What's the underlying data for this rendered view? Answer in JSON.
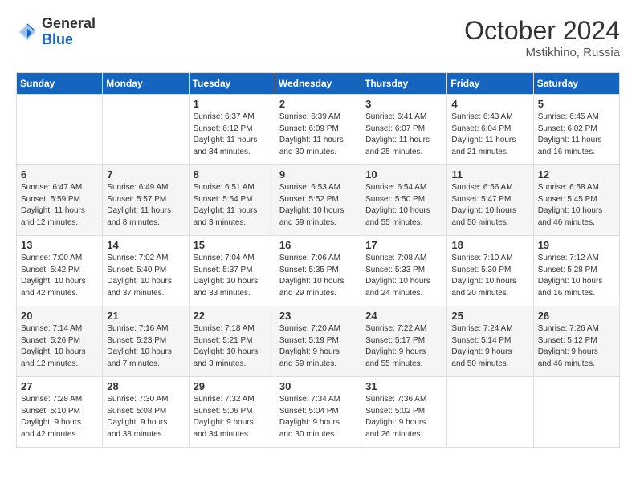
{
  "header": {
    "logo_general": "General",
    "logo_blue": "Blue",
    "month_title": "October 2024",
    "location": "Mstikhino, Russia"
  },
  "days_of_week": [
    "Sunday",
    "Monday",
    "Tuesday",
    "Wednesday",
    "Thursday",
    "Friday",
    "Saturday"
  ],
  "weeks": [
    [
      {
        "day": "",
        "content": ""
      },
      {
        "day": "",
        "content": ""
      },
      {
        "day": "1",
        "content": "Sunrise: 6:37 AM\nSunset: 6:12 PM\nDaylight: 11 hours\nand 34 minutes."
      },
      {
        "day": "2",
        "content": "Sunrise: 6:39 AM\nSunset: 6:09 PM\nDaylight: 11 hours\nand 30 minutes."
      },
      {
        "day": "3",
        "content": "Sunrise: 6:41 AM\nSunset: 6:07 PM\nDaylight: 11 hours\nand 25 minutes."
      },
      {
        "day": "4",
        "content": "Sunrise: 6:43 AM\nSunset: 6:04 PM\nDaylight: 11 hours\nand 21 minutes."
      },
      {
        "day": "5",
        "content": "Sunrise: 6:45 AM\nSunset: 6:02 PM\nDaylight: 11 hours\nand 16 minutes."
      }
    ],
    [
      {
        "day": "6",
        "content": "Sunrise: 6:47 AM\nSunset: 5:59 PM\nDaylight: 11 hours\nand 12 minutes."
      },
      {
        "day": "7",
        "content": "Sunrise: 6:49 AM\nSunset: 5:57 PM\nDaylight: 11 hours\nand 8 minutes."
      },
      {
        "day": "8",
        "content": "Sunrise: 6:51 AM\nSunset: 5:54 PM\nDaylight: 11 hours\nand 3 minutes."
      },
      {
        "day": "9",
        "content": "Sunrise: 6:53 AM\nSunset: 5:52 PM\nDaylight: 10 hours\nand 59 minutes."
      },
      {
        "day": "10",
        "content": "Sunrise: 6:54 AM\nSunset: 5:50 PM\nDaylight: 10 hours\nand 55 minutes."
      },
      {
        "day": "11",
        "content": "Sunrise: 6:56 AM\nSunset: 5:47 PM\nDaylight: 10 hours\nand 50 minutes."
      },
      {
        "day": "12",
        "content": "Sunrise: 6:58 AM\nSunset: 5:45 PM\nDaylight: 10 hours\nand 46 minutes."
      }
    ],
    [
      {
        "day": "13",
        "content": "Sunrise: 7:00 AM\nSunset: 5:42 PM\nDaylight: 10 hours\nand 42 minutes."
      },
      {
        "day": "14",
        "content": "Sunrise: 7:02 AM\nSunset: 5:40 PM\nDaylight: 10 hours\nand 37 minutes."
      },
      {
        "day": "15",
        "content": "Sunrise: 7:04 AM\nSunset: 5:37 PM\nDaylight: 10 hours\nand 33 minutes."
      },
      {
        "day": "16",
        "content": "Sunrise: 7:06 AM\nSunset: 5:35 PM\nDaylight: 10 hours\nand 29 minutes."
      },
      {
        "day": "17",
        "content": "Sunrise: 7:08 AM\nSunset: 5:33 PM\nDaylight: 10 hours\nand 24 minutes."
      },
      {
        "day": "18",
        "content": "Sunrise: 7:10 AM\nSunset: 5:30 PM\nDaylight: 10 hours\nand 20 minutes."
      },
      {
        "day": "19",
        "content": "Sunrise: 7:12 AM\nSunset: 5:28 PM\nDaylight: 10 hours\nand 16 minutes."
      }
    ],
    [
      {
        "day": "20",
        "content": "Sunrise: 7:14 AM\nSunset: 5:26 PM\nDaylight: 10 hours\nand 12 minutes."
      },
      {
        "day": "21",
        "content": "Sunrise: 7:16 AM\nSunset: 5:23 PM\nDaylight: 10 hours\nand 7 minutes."
      },
      {
        "day": "22",
        "content": "Sunrise: 7:18 AM\nSunset: 5:21 PM\nDaylight: 10 hours\nand 3 minutes."
      },
      {
        "day": "23",
        "content": "Sunrise: 7:20 AM\nSunset: 5:19 PM\nDaylight: 9 hours\nand 59 minutes."
      },
      {
        "day": "24",
        "content": "Sunrise: 7:22 AM\nSunset: 5:17 PM\nDaylight: 9 hours\nand 55 minutes."
      },
      {
        "day": "25",
        "content": "Sunrise: 7:24 AM\nSunset: 5:14 PM\nDaylight: 9 hours\nand 50 minutes."
      },
      {
        "day": "26",
        "content": "Sunrise: 7:26 AM\nSunset: 5:12 PM\nDaylight: 9 hours\nand 46 minutes."
      }
    ],
    [
      {
        "day": "27",
        "content": "Sunrise: 7:28 AM\nSunset: 5:10 PM\nDaylight: 9 hours\nand 42 minutes."
      },
      {
        "day": "28",
        "content": "Sunrise: 7:30 AM\nSunset: 5:08 PM\nDaylight: 9 hours\nand 38 minutes."
      },
      {
        "day": "29",
        "content": "Sunrise: 7:32 AM\nSunset: 5:06 PM\nDaylight: 9 hours\nand 34 minutes."
      },
      {
        "day": "30",
        "content": "Sunrise: 7:34 AM\nSunset: 5:04 PM\nDaylight: 9 hours\nand 30 minutes."
      },
      {
        "day": "31",
        "content": "Sunrise: 7:36 AM\nSunset: 5:02 PM\nDaylight: 9 hours\nand 26 minutes."
      },
      {
        "day": "",
        "content": ""
      },
      {
        "day": "",
        "content": ""
      }
    ]
  ]
}
